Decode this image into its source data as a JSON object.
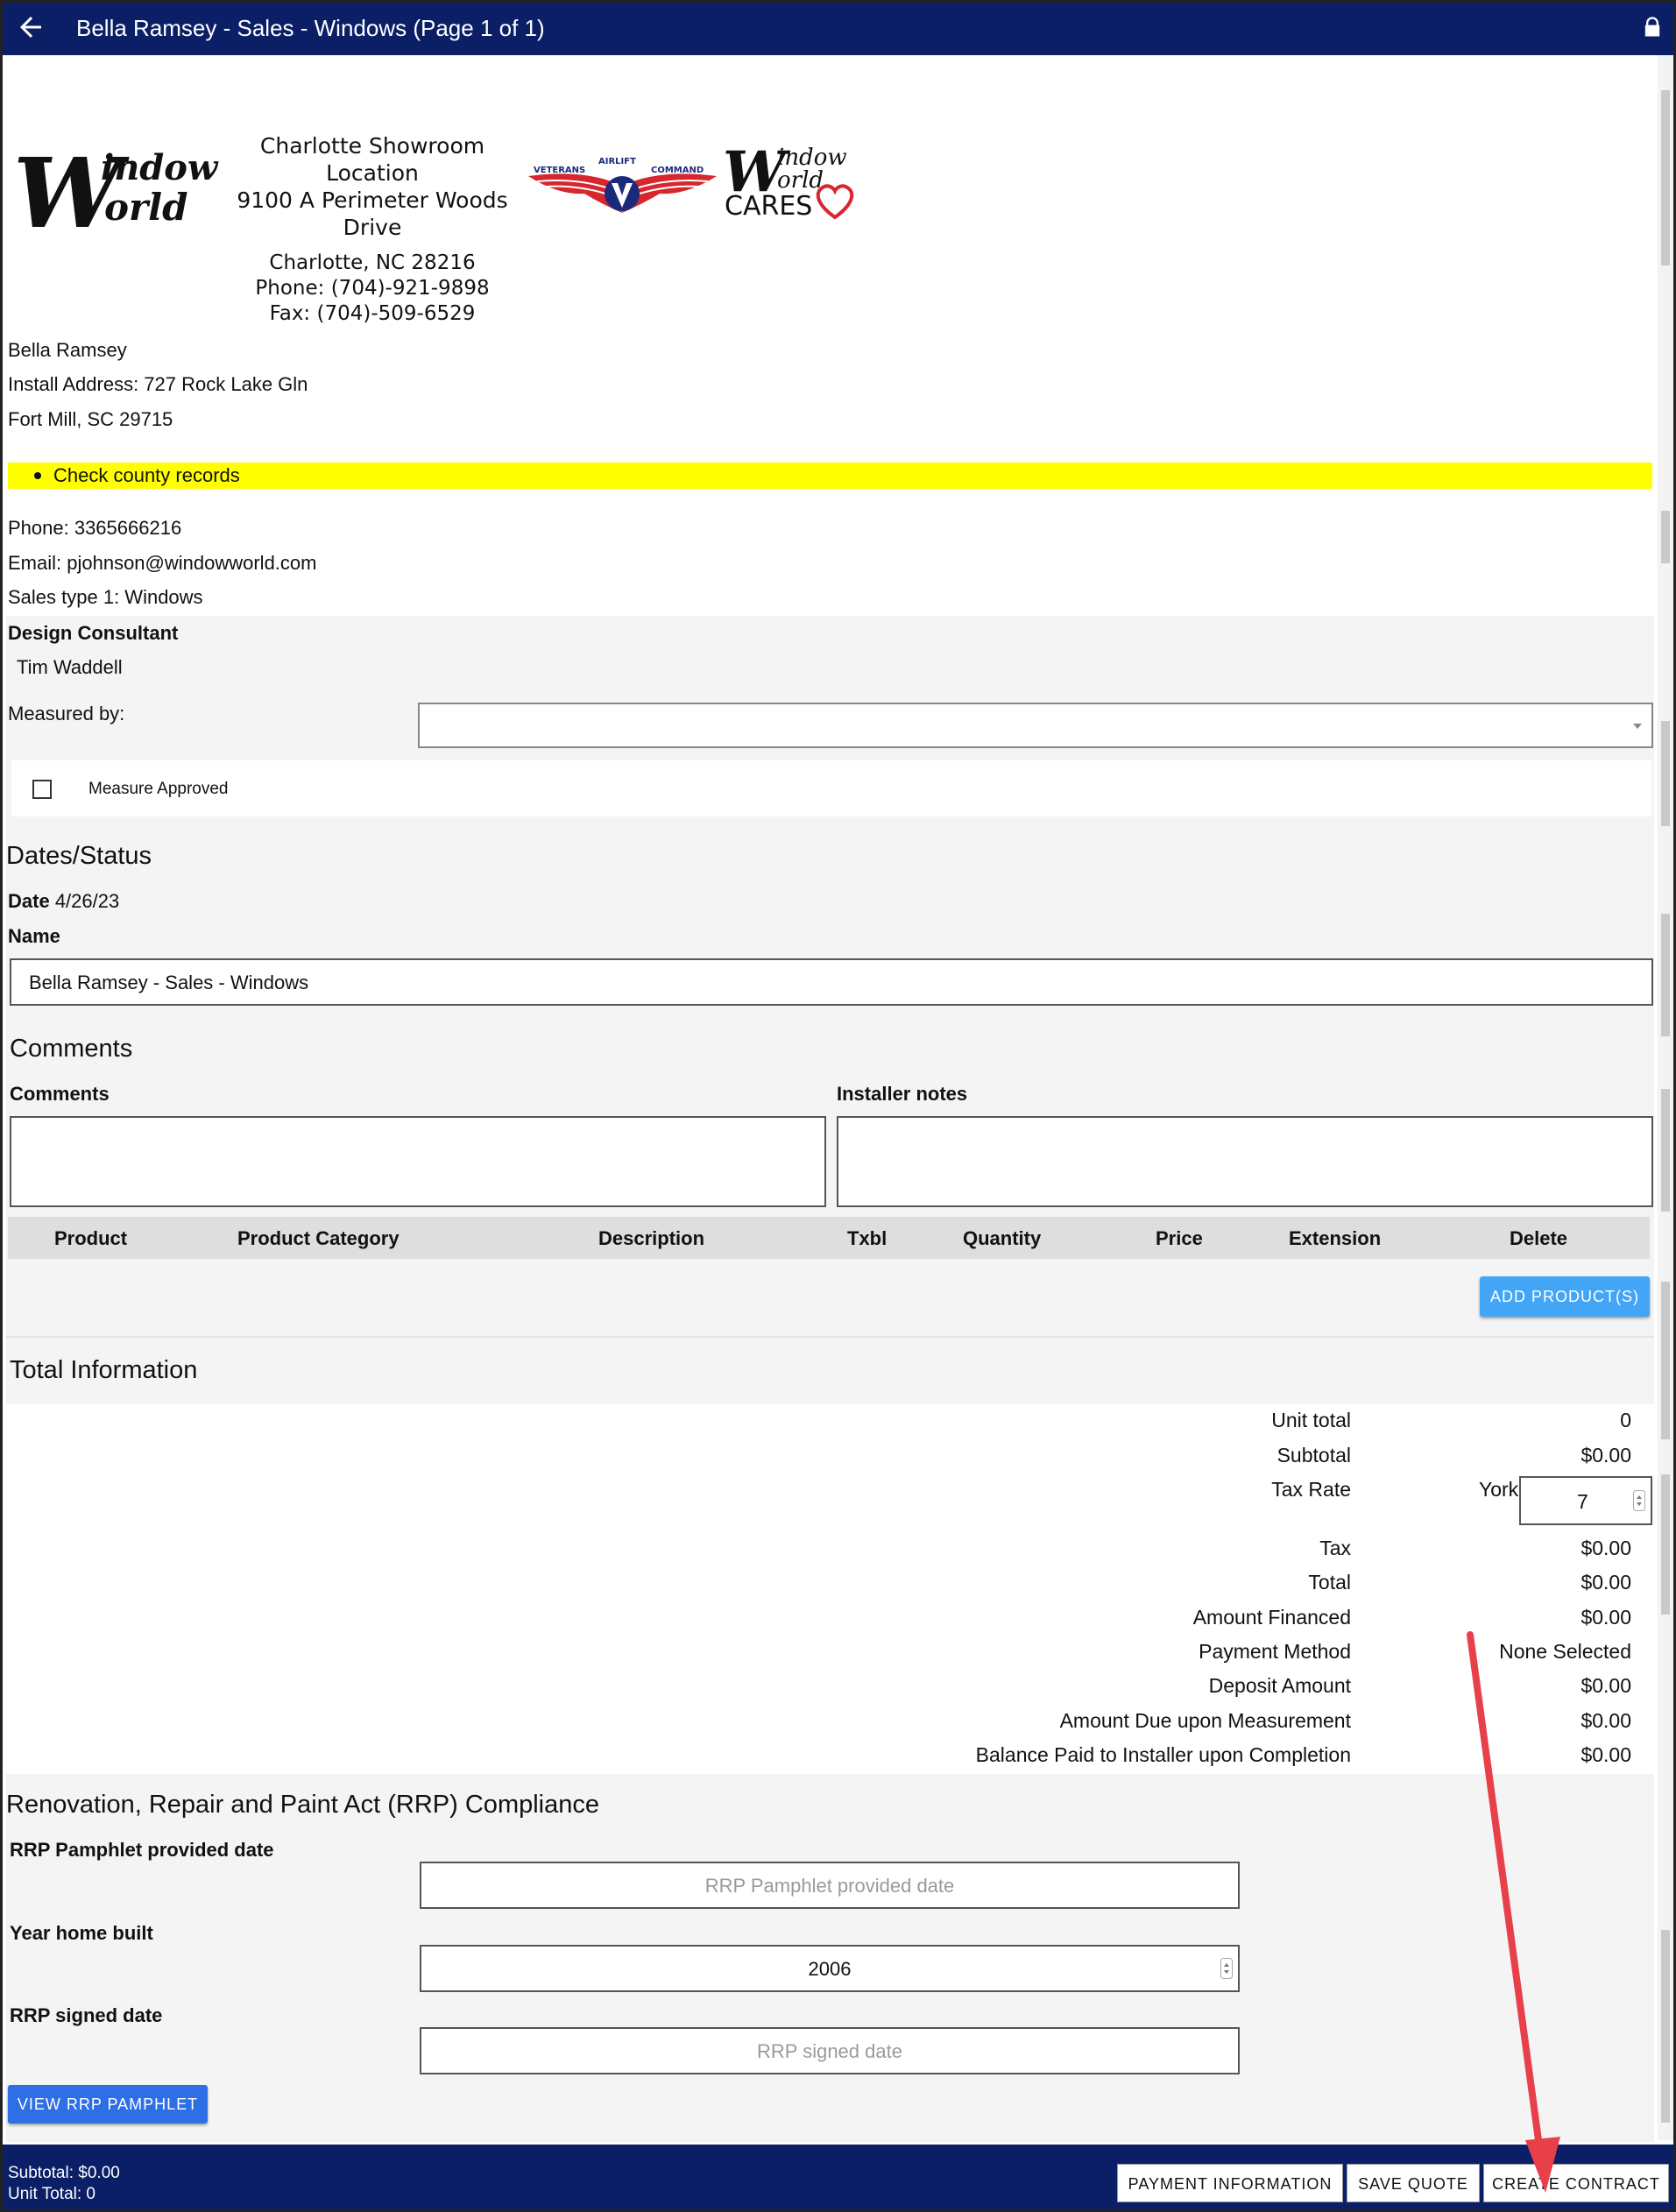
{
  "topbar": {
    "title": "Bella Ramsey - Sales - Windows (Page 1 of 1)"
  },
  "header": {
    "logo_text_1": "indow",
    "logo_text_2": "orld",
    "showroom_name": "Charlotte Showroom",
    "location": "Location",
    "address_1": "9100 A Perimeter Woods",
    "address_2": "Drive",
    "city": "Charlotte, NC 28216",
    "phone": "Phone: (704)-921-9898",
    "fax": "Fax: (704)-509-6529",
    "veterans_text_1": "VETERANS",
    "veterans_text_2": "AIRLIFT",
    "veterans_text_3": "COMMAND",
    "cares_text_1": "indow",
    "cares_text_2": "orld",
    "cares_text_3": "CARES"
  },
  "customer": {
    "name": "Bella Ramsey",
    "install_address": "Install Address: 727 Rock Lake Gln",
    "city": "Fort Mill, SC 29715",
    "note": "Check county records",
    "phone": "Phone: 3365666216",
    "email": "Email: pjohnson@windowworld.com",
    "sales_type": "Sales type 1: Windows"
  },
  "consultant": {
    "label": "Design Consultant",
    "name": "Tim Waddell",
    "measured_by_label": "Measured by:",
    "measured_by_value": "",
    "measure_approved_label": "Measure Approved",
    "measure_approved_checked": false
  },
  "dates": {
    "heading": "Dates/Status",
    "date_label": "Date",
    "date_value": "4/26/23",
    "name_label": "Name",
    "name_value": "Bella Ramsey - Sales - Windows"
  },
  "comments": {
    "heading": "Comments",
    "comments_label": "Comments",
    "comments_value": "",
    "installer_label": "Installer notes",
    "installer_value": ""
  },
  "products": {
    "columns": [
      "Product",
      "Product Category",
      "Description",
      "Txbl",
      "Quantity",
      "Price",
      "Extension",
      "Delete"
    ],
    "add_button": "ADD PRODUCT(S)"
  },
  "totals": {
    "heading": "Total Information",
    "unit_total_label": "Unit total",
    "unit_total": "0",
    "subtotal_label": "Subtotal",
    "subtotal": "$0.00",
    "tax_rate_label": "Tax Rate",
    "tax_county": "York",
    "tax_rate": "7",
    "tax_label": "Tax",
    "tax": "$0.00",
    "total_label": "Total",
    "total": "$0.00",
    "financed_label": "Amount Financed",
    "financed": "$0.00",
    "payment_method_label": "Payment Method",
    "payment_method": "None Selected",
    "deposit_label": "Deposit Amount",
    "deposit": "$0.00",
    "due_measure_label": "Amount Due upon Measurement",
    "due_measure": "$0.00",
    "balance_label": "Balance Paid to Installer upon Completion",
    "balance": "$0.00"
  },
  "rrp": {
    "heading": "Renovation, Repair and Paint Act (RRP) Compliance",
    "pamphlet_label": "RRP Pamphlet provided date",
    "pamphlet_placeholder": "RRP Pamphlet provided date",
    "year_label": "Year home built",
    "year_value": "2006",
    "signed_label": "RRP signed date",
    "signed_placeholder": "RRP signed date",
    "view_button": "VIEW RRP PAMPHLET"
  },
  "footer": {
    "subtotal": "Subtotal: $0.00",
    "unit_total": "Unit Total: 0",
    "payment_button": "PAYMENT INFORMATION",
    "save_button": "SAVE QUOTE",
    "contract_button": "CREATE CONTRACT"
  },
  "colors": {
    "navy": "#0a1f66",
    "highlight": "#ffff00",
    "button_blue": "#42a5f5",
    "annotation_arrow": "#e8404a"
  }
}
